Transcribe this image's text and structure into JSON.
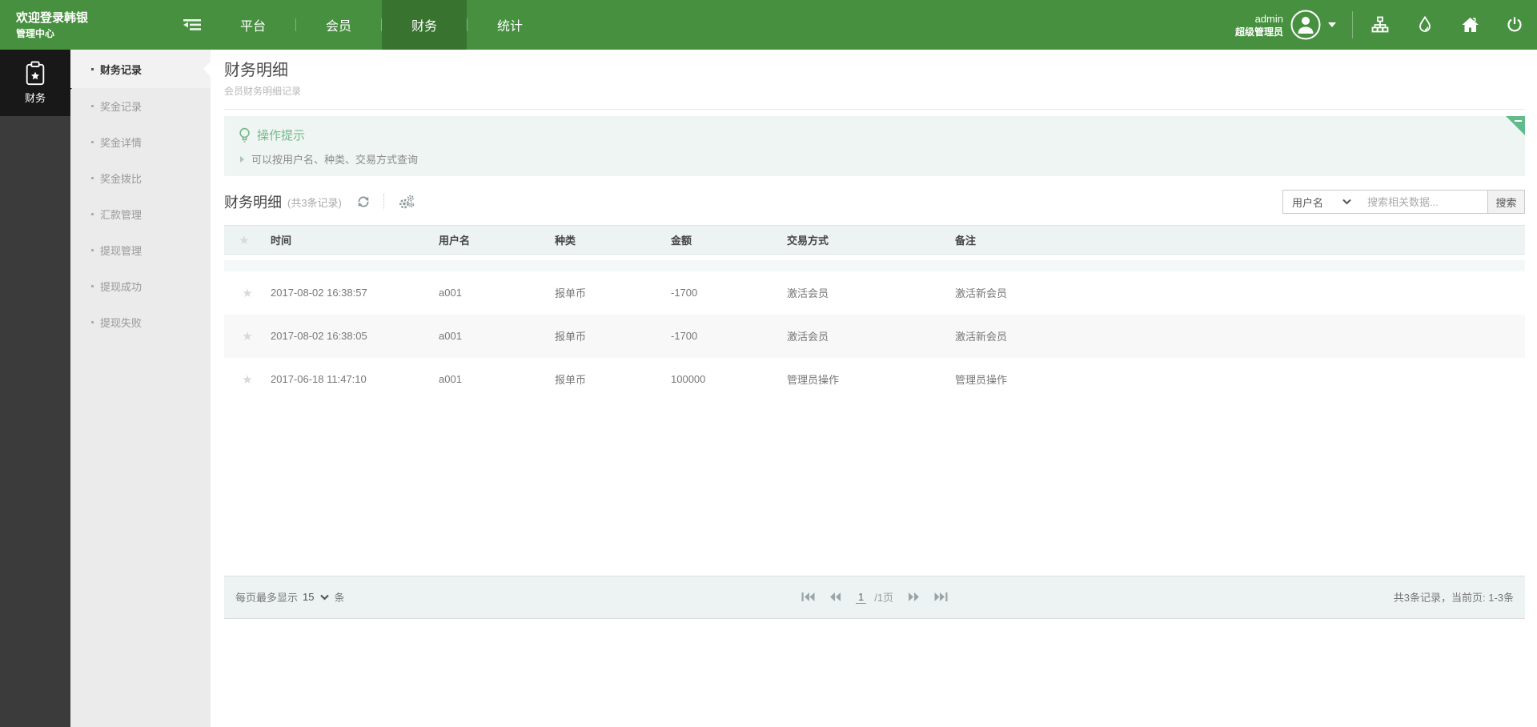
{
  "topbar": {
    "welcome_title": "欢迎登录韩银",
    "welcome_subtitle": "管理中心",
    "nav": [
      {
        "label": "平台",
        "active": false
      },
      {
        "label": "会员",
        "active": false
      },
      {
        "label": "财务",
        "active": true
      },
      {
        "label": "统计",
        "active": false
      }
    ],
    "user": {
      "name": "admin",
      "role": "超级管理员"
    }
  },
  "sidebar": {
    "module_label": "财务",
    "items": [
      {
        "label": "财务记录",
        "active": true
      },
      {
        "label": "奖金记录",
        "active": false
      },
      {
        "label": "奖金详情",
        "active": false
      },
      {
        "label": "奖金拨比",
        "active": false
      },
      {
        "label": "汇款管理",
        "active": false
      },
      {
        "label": "提现管理",
        "active": false
      },
      {
        "label": "提现成功",
        "active": false
      },
      {
        "label": "提现失败",
        "active": false
      }
    ]
  },
  "page": {
    "title": "财务明细",
    "subtitle": "会员财务明细记录"
  },
  "tips": {
    "title": "操作提示",
    "items": [
      "可以按用户名、种类、交易方式查询"
    ]
  },
  "table": {
    "title": "财务明细",
    "count_label": "(共3条记录)",
    "search": {
      "field": "用户名",
      "placeholder": "搜索相关数据...",
      "button_label": "搜索"
    },
    "columns": [
      "时间",
      "用户名",
      "种类",
      "金额",
      "交易方式",
      "备注"
    ],
    "rows": [
      [
        "2017-08-02 16:38:57",
        "a001",
        "报单币",
        "-1700",
        "激活会员",
        "激活新会员"
      ],
      [
        "2017-08-02 16:38:05",
        "a001",
        "报单币",
        "-1700",
        "激活会员",
        "激活新会员"
      ],
      [
        "2017-06-18 11:47:10",
        "a001",
        "报单币",
        "100000",
        "管理员操作",
        "管理员操作"
      ]
    ]
  },
  "pagination": {
    "page_size_prefix": "每页最多显示",
    "page_size": "15",
    "page_size_suffix": "条",
    "current_page": "1",
    "page_total_label": "/1页",
    "summary": "共3条记录，当前页: 1-3条"
  },
  "colors": {
    "brand_green": "#46903F",
    "nav_active_green": "#38742F",
    "tip_green": "#74B98C",
    "fold_green": "#62BB8A",
    "band_gray_green": "#EDF3F3",
    "sidebar_dark": "#3B3B3B",
    "module_block_dark": "#181818"
  }
}
